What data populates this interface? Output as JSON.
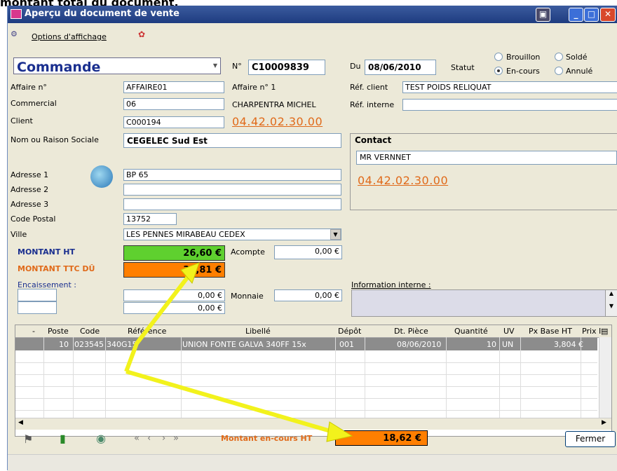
{
  "caption": "montant total du document.",
  "window": {
    "title": "Aperçu du document de vente"
  },
  "toolbar": {
    "options_label": "Options d'affichage"
  },
  "doc": {
    "type": "Commande",
    "num_label": "N°",
    "num_value": "C10009839",
    "date_label": "Du",
    "date_value": "08/06/2010",
    "statut_label": "Statut",
    "statut_options": [
      "Brouillon",
      "Soldé",
      "En-cours",
      "Annulé"
    ]
  },
  "form": {
    "affaire_label": "Affaire n°",
    "affaire_value": "AFFAIRE01",
    "affaire1_label": "Affaire n° 1",
    "ref_client_label": "Réf. client",
    "ref_client_value": "TEST POIDS RELIQUAT",
    "commercial_label": "Commercial",
    "commercial_value": "06",
    "commercial_name": "CHARPENTRA MICHEL",
    "ref_interne_label": "Réf. interne",
    "ref_interne_value": "",
    "client_label": "Client",
    "client_value": "C000194",
    "client_phone": "04.42.02.30.00",
    "nom_label": "Nom ou Raison Sociale",
    "nom_value": "CEGELEC Sud Est",
    "contact_title": "Contact",
    "contact_name": "MR VERNNET",
    "contact_phone": "04.42.02.30.00",
    "adresse1_label": "Adresse 1",
    "adresse1_value": "BP 65",
    "adresse2_label": "Adresse 2",
    "adresse2_value": "",
    "adresse3_label": "Adresse 3",
    "adresse3_value": "",
    "cp_label": "Code Postal",
    "cp_value": "13752",
    "ville_label": "Ville",
    "ville_value": "LES PENNES MIRABEAU CEDEX"
  },
  "totals": {
    "ht_label": "MONTANT HT",
    "ht_value": "26,60 €",
    "acompte_label": "Acompte",
    "acompte_value": "0,00 €",
    "ttc_label": "MONTANT TTC DÛ",
    "ttc_value": "31,81 €",
    "encaissement_label": "Encaissement :",
    "enc1_value": "0,00 €",
    "enc2_value": "0,00 €",
    "monnaie_label": "Monnaie",
    "monnaie_value": "0,00 €",
    "info_label": "Information interne :"
  },
  "grid": {
    "columns": [
      "-",
      "Poste",
      "Code",
      "Référence",
      "Libellé",
      "Dépôt",
      "Dt. Pièce",
      "Quantité",
      "UV",
      "Px Base HT",
      "Prix I"
    ],
    "row": [
      "10",
      "023545",
      "340G15",
      "UNION FONTE GALVA 340FF 15x",
      "001",
      "08/06/2010",
      "10",
      "UN",
      "3,804 €"
    ]
  },
  "footer": {
    "montant_label": "Montant en-cours  HT",
    "montant_value": "18,62 €",
    "fermer_label": "Fermer"
  },
  "colors": {
    "accent_orange": "#e06a1a",
    "ht_green": "#5fd02f",
    "ttc_orange": "#ff7f00",
    "arrow_yellow": "#f2f21c"
  }
}
